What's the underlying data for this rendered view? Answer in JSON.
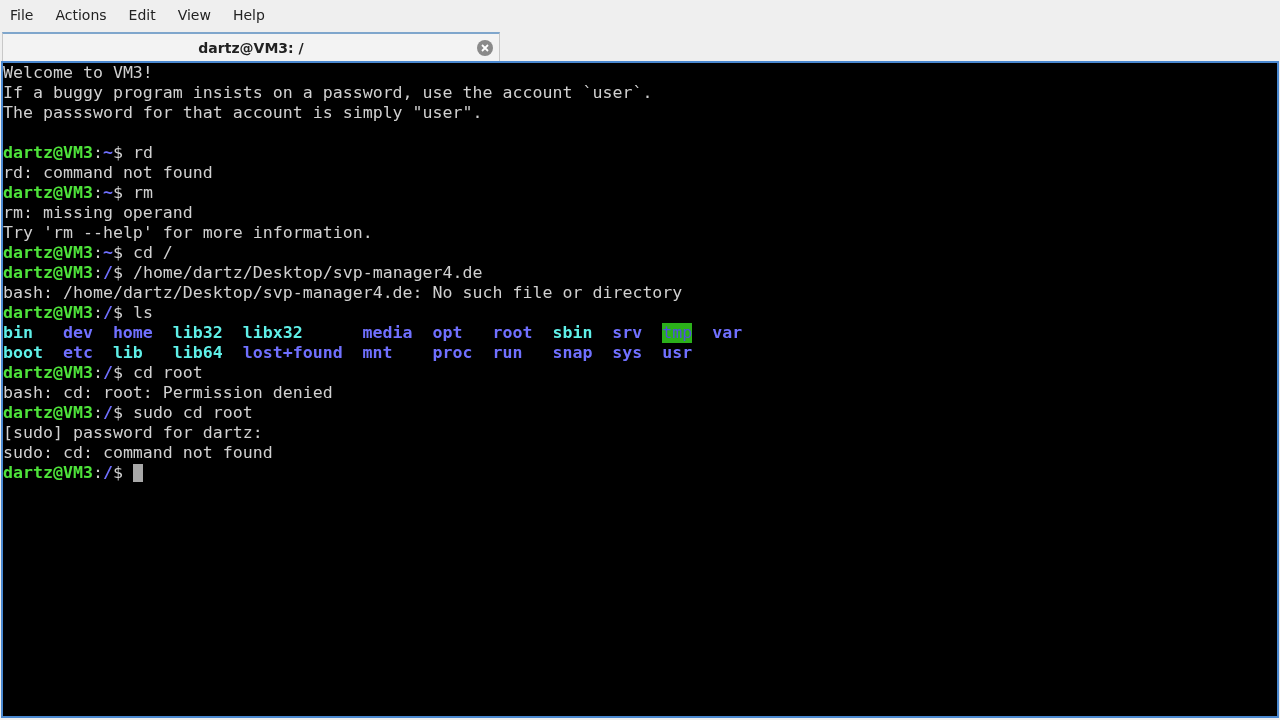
{
  "menu": [
    "File",
    "Actions",
    "Edit",
    "View",
    "Help"
  ],
  "tabs": [
    {
      "title": "dartz@VM3: /",
      "selected": true
    }
  ],
  "terminal": {
    "lines": [
      [
        {
          "kind": "plain",
          "text": "Welcome to VM3!"
        }
      ],
      [
        {
          "kind": "plain",
          "text": "If a buggy program insists on a password, use the account `user`."
        }
      ],
      [
        {
          "kind": "plain",
          "text": "The passsword for that account is simply \"user\"."
        }
      ],
      [
        {
          "kind": "blank"
        }
      ],
      [
        {
          "kind": "user",
          "text": "dartz@VM3"
        },
        {
          "kind": "plain",
          "text": ":"
        },
        {
          "kind": "path",
          "text": "~"
        },
        {
          "kind": "plain",
          "text": "$ rd"
        }
      ],
      [
        {
          "kind": "plain",
          "text": "rd: command not found"
        }
      ],
      [
        {
          "kind": "user",
          "text": "dartz@VM3"
        },
        {
          "kind": "plain",
          "text": ":"
        },
        {
          "kind": "path",
          "text": "~"
        },
        {
          "kind": "plain",
          "text": "$ rm"
        }
      ],
      [
        {
          "kind": "plain",
          "text": "rm: missing operand"
        }
      ],
      [
        {
          "kind": "plain",
          "text": "Try 'rm --help' for more information."
        }
      ],
      [
        {
          "kind": "user",
          "text": "dartz@VM3"
        },
        {
          "kind": "plain",
          "text": ":"
        },
        {
          "kind": "path",
          "text": "~"
        },
        {
          "kind": "plain",
          "text": "$ cd /"
        }
      ],
      [
        {
          "kind": "user",
          "text": "dartz@VM3"
        },
        {
          "kind": "plain",
          "text": ":"
        },
        {
          "kind": "path",
          "text": "/"
        },
        {
          "kind": "plain",
          "text": "$ /home/dartz/Desktop/svp-manager4.de"
        }
      ],
      [
        {
          "kind": "plain",
          "text": "bash: /home/dartz/Desktop/svp-manager4.de: No such file or directory"
        }
      ],
      [
        {
          "kind": "user",
          "text": "dartz@VM3"
        },
        {
          "kind": "plain",
          "text": ":"
        },
        {
          "kind": "path",
          "text": "/"
        },
        {
          "kind": "plain",
          "text": "$ ls"
        }
      ],
      {
        "listing": [
          {
            "kind": "link",
            "text": "bin"
          },
          {
            "kind": "dir",
            "text": "dev"
          },
          {
            "kind": "dir",
            "text": "home"
          },
          {
            "kind": "link",
            "text": "lib32"
          },
          {
            "kind": "link",
            "text": "libx32"
          },
          {
            "kind": "dir",
            "text": "media"
          },
          {
            "kind": "dir",
            "text": "opt"
          },
          {
            "kind": "dir",
            "text": "root"
          },
          {
            "kind": "link",
            "text": "sbin"
          },
          {
            "kind": "dir",
            "text": "srv"
          },
          {
            "kind": "sticky",
            "text": "tmp"
          },
          {
            "kind": "dir",
            "text": "var"
          },
          {
            "kind": "link",
            "text": "boot"
          },
          {
            "kind": "dir",
            "text": "etc"
          },
          {
            "kind": "link",
            "text": "lib"
          },
          {
            "kind": "link",
            "text": "lib64"
          },
          {
            "kind": "dir",
            "text": "lost+found"
          },
          {
            "kind": "dir",
            "text": "mnt"
          },
          {
            "kind": "dir",
            "text": "proc"
          },
          {
            "kind": "dir",
            "text": "run"
          },
          {
            "kind": "dir",
            "text": "snap"
          },
          {
            "kind": "dir",
            "text": "sys"
          },
          {
            "kind": "dir",
            "text": "usr"
          }
        ]
      },
      [
        {
          "kind": "user",
          "text": "dartz@VM3"
        },
        {
          "kind": "plain",
          "text": ":"
        },
        {
          "kind": "path",
          "text": "/"
        },
        {
          "kind": "plain",
          "text": "$ cd root"
        }
      ],
      [
        {
          "kind": "plain",
          "text": "bash: cd: root: Permission denied"
        }
      ],
      [
        {
          "kind": "user",
          "text": "dartz@VM3"
        },
        {
          "kind": "plain",
          "text": ":"
        },
        {
          "kind": "path",
          "text": "/"
        },
        {
          "kind": "plain",
          "text": "$ sudo cd root"
        }
      ],
      [
        {
          "kind": "plain",
          "text": "[sudo] password for dartz:"
        }
      ],
      [
        {
          "kind": "plain",
          "text": "sudo: cd: command not found"
        }
      ],
      [
        {
          "kind": "user",
          "text": "dartz@VM3"
        },
        {
          "kind": "plain",
          "text": ":"
        },
        {
          "kind": "path",
          "text": "/"
        },
        {
          "kind": "plain",
          "text": "$ "
        },
        {
          "kind": "cursor"
        }
      ]
    ]
  }
}
